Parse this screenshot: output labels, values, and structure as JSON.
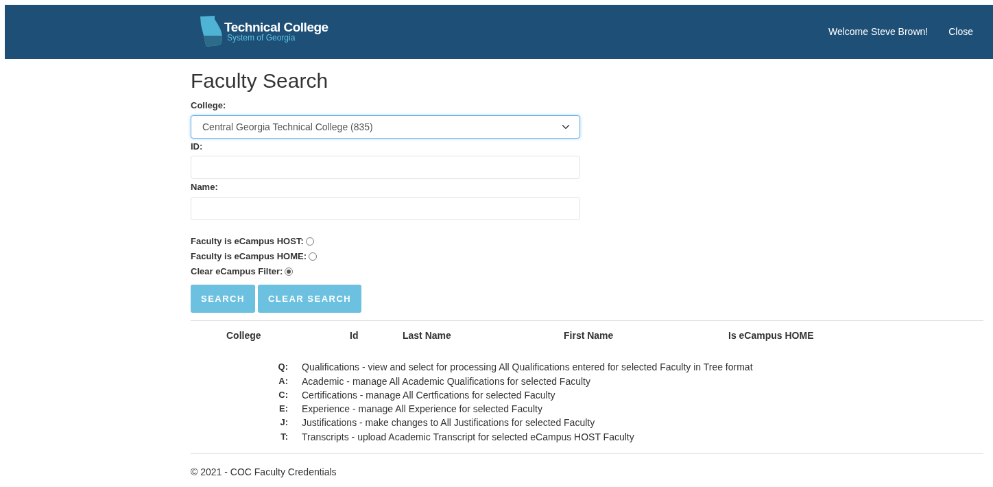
{
  "header": {
    "logo_title": "Technical College",
    "logo_subtitle": "System of Georgia",
    "welcome": "Welcome Steve Brown!",
    "close": "Close"
  },
  "page_title": "Faculty Search",
  "fields": [
    {
      "kind": "select",
      "label": "College:",
      "value": "Central Georgia Technical College (835)"
    },
    {
      "kind": "text",
      "label": "ID:"
    },
    {
      "kind": "text",
      "label": "Name:"
    }
  ],
  "filters": [
    {
      "label": "Faculty is eCampus HOST:",
      "selected": false
    },
    {
      "label": "Faculty is eCampus HOME:",
      "selected": false
    },
    {
      "label": "Clear eCampus Filter:",
      "selected": true
    }
  ],
  "buttons": [
    "SEARCH",
    "CLEAR SEARCH"
  ],
  "table": {
    "columns": [
      "College",
      "Id",
      "Last Name",
      "First Name",
      "Is eCampus HOME"
    ]
  },
  "legend": [
    {
      "key": "Q:",
      "text": "Qualifications - view and select for processing All Qualifications entered for selected Faculty in Tree format"
    },
    {
      "key": "A:",
      "text": "Academic - manage All Academic Qualifications for selected Faculty"
    },
    {
      "key": "C:",
      "text": "Certifications - manage All Certfications for selected Faculty"
    },
    {
      "key": "E:",
      "text": "Experience - manage All Experience for selected Faculty"
    },
    {
      "key": "J:",
      "text": "Justifications - make changes to All Justifications for selected Faculty"
    },
    {
      "key": "T:",
      "text": "Transcripts - upload Academic Transcript for selected eCampus HOST Faculty"
    }
  ],
  "footer": "© 2021 - COC Faculty Credentials"
}
